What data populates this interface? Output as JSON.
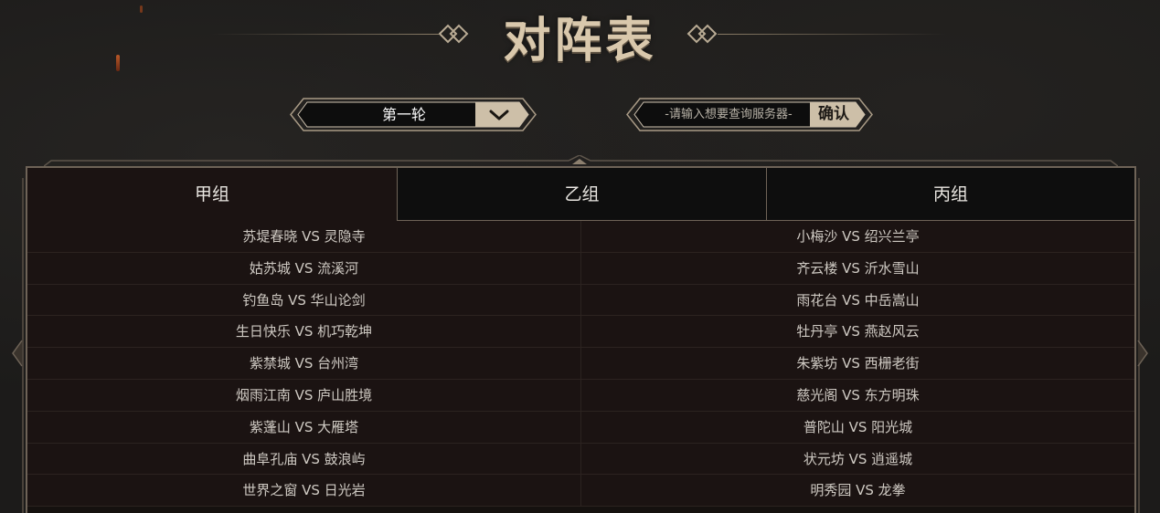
{
  "header": {
    "title": "对阵表"
  },
  "round_select": {
    "selected": "第一轮"
  },
  "search": {
    "placeholder": "-请输入想要查询服务器-",
    "value": "",
    "confirm_label": "确认"
  },
  "tabs": [
    {
      "label": "甲组",
      "active": true
    },
    {
      "label": "乙组",
      "active": false
    },
    {
      "label": "丙组",
      "active": false
    }
  ],
  "matches": [
    {
      "left": "苏堤春晓 VS 灵隐寺",
      "right": "小梅沙 VS 绍兴兰亭"
    },
    {
      "left": "姑苏城 VS 流溪河",
      "right": "齐云楼 VS 沂水雪山"
    },
    {
      "left": "钓鱼岛 VS 华山论剑",
      "right": "雨花台 VS 中岳嵩山"
    },
    {
      "left": "生日快乐 VS 机巧乾坤",
      "right": "牡丹亭 VS 燕赵风云"
    },
    {
      "left": "紫禁城 VS 台州湾",
      "right": "朱紫坊 VS 西栅老街"
    },
    {
      "left": "烟雨江南 VS 庐山胜境",
      "right": "慈光阁 VS 东方明珠"
    },
    {
      "left": "紫蓬山 VS 大雁塔",
      "right": "普陀山 VS 阳光城"
    },
    {
      "left": "曲阜孔庙 VS 鼓浪屿",
      "right": "状元坊 VS 逍遥城"
    },
    {
      "left": "世界之窗 VS 日光岩",
      "right": "明秀园 VS 龙拳"
    }
  ],
  "colors": {
    "accent_gold": "#d9c8ac",
    "panel_bg": "#1b1312",
    "border": "#6e6357"
  },
  "icons": {
    "dropdown": "chevron-down-icon",
    "decoration": "double-diamond-icon"
  }
}
